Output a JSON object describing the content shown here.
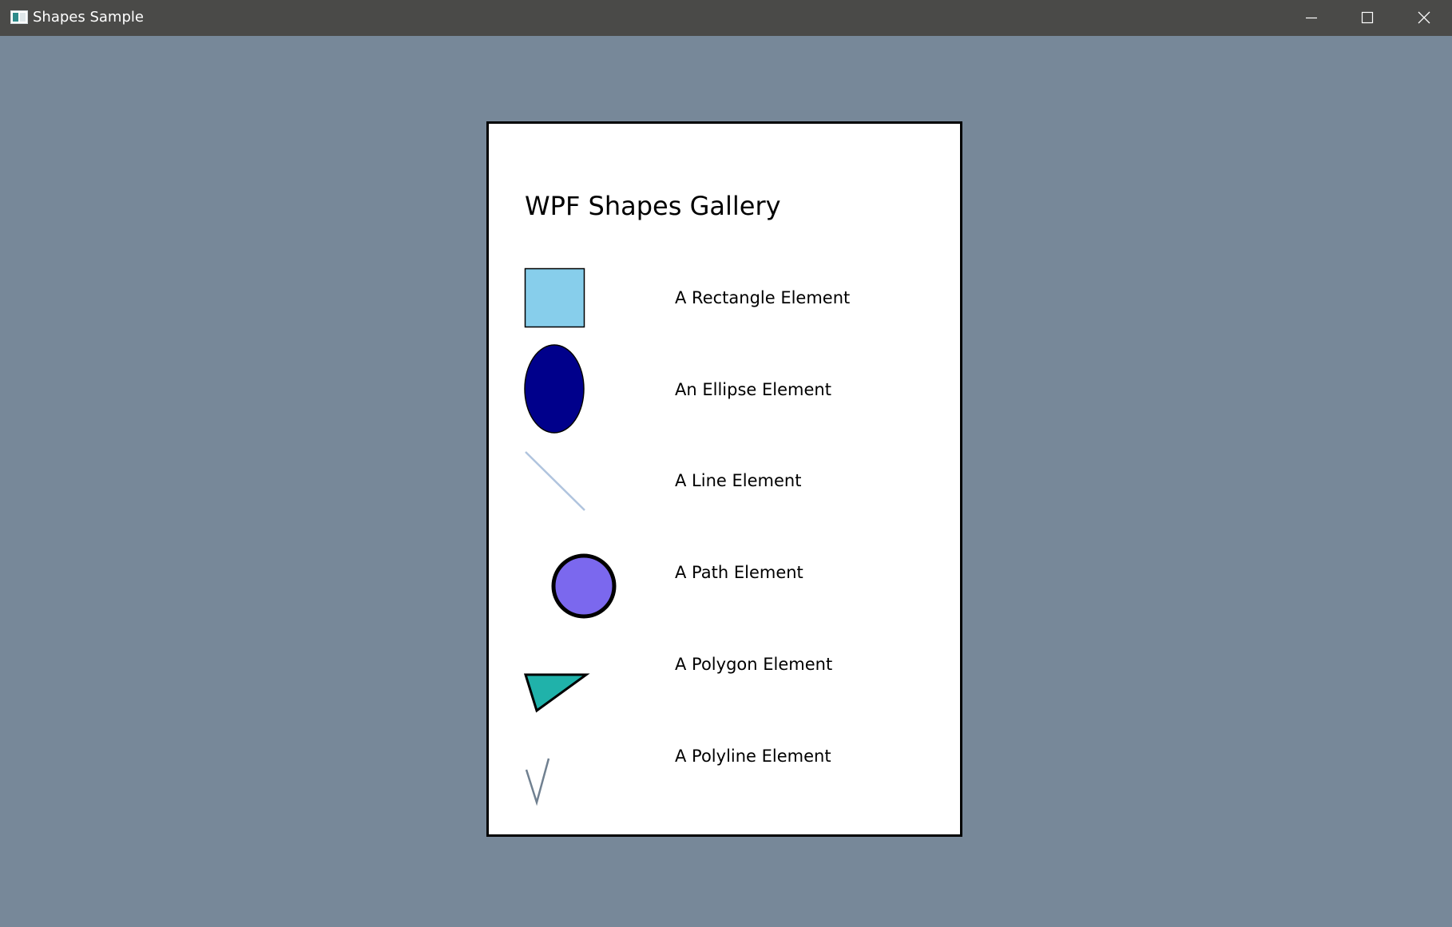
{
  "window": {
    "title": "Shapes Sample",
    "icon": "app-window-icon",
    "controls": {
      "minimize": "minimize-icon",
      "maximize": "maximize-icon",
      "close": "close-icon"
    },
    "background_color": "#778899",
    "titlebar_color": "#4a4a48"
  },
  "gallery": {
    "title": "WPF Shapes Gallery",
    "items": [
      {
        "label": "A Rectangle Element",
        "shape": "rectangle",
        "fill": "#87ceeb",
        "stroke": "#000000"
      },
      {
        "label": "An Ellipse Element",
        "shape": "ellipse",
        "fill": "#00008b",
        "stroke": "#000000"
      },
      {
        "label": "A Line Element",
        "shape": "line",
        "stroke": "#b0c4de"
      },
      {
        "label": "A Path Element",
        "shape": "path-circle",
        "fill": "#7b68ee",
        "stroke": "#000000"
      },
      {
        "label": "A Polygon Element",
        "shape": "polygon",
        "fill": "#20b2aa",
        "stroke": "#000000"
      },
      {
        "label": "A Polyline Element",
        "shape": "polyline",
        "stroke": "#708090"
      }
    ]
  }
}
